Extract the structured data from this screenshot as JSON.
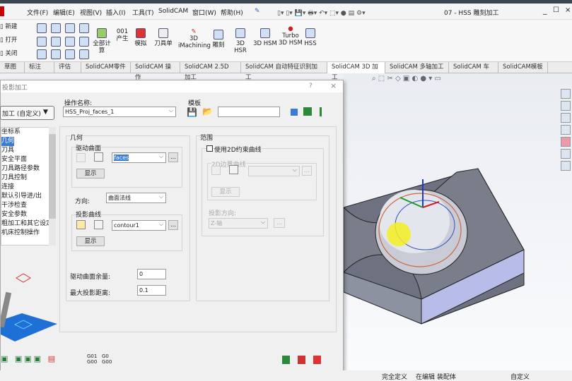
{
  "menu": [
    "文件(F)",
    "编辑(E)",
    "视图(V)",
    "插入(I)",
    "工具(T)",
    "SolidCAM",
    "窗口(W)",
    "帮助(H)"
  ],
  "window_title": "07 - HSS 雕刻加工",
  "ribbon": {
    "new": "新建",
    "open": "打开",
    "close": "关闭",
    "calc_all": "全部计算",
    "generate": "产生",
    "simulate": "模拟",
    "tool_sheet": "刀具单",
    "imachining": "3D iMachining",
    "engrave": "雕刻",
    "hsr": "3D HSR",
    "hsm": "3D HSM",
    "turbo": "Turbo 3D HSM",
    "hss": "HSS"
  },
  "tabs": [
    "草图",
    "标注",
    "评估",
    "SolidCAM零件",
    "SolidCAM 操作",
    "SolidCAM 2.5D 加工",
    "SolidCAM 自动特征识别加工",
    "SolidCAM 3D 加工",
    "SolidCAM 多轴加工",
    "SolidCAM 车削",
    "SolidCAM模板"
  ],
  "active_tab": "SolidCAM 3D 加工",
  "dialog": {
    "title": "投影加工",
    "help": "?",
    "close": "×",
    "type_select": "加工 (自定义)",
    "tree": [
      "坐标系",
      "几何",
      "刀具",
      "安全平面",
      "刀具路径参数",
      "刀具控制",
      "连接",
      "默认引导进/出",
      "干涉检查",
      "安全参数",
      "粗加工和其它设定",
      "机床控制操作"
    ],
    "selected_tree": "几何",
    "op_name_label": "操作名称:",
    "op_name": "HSS_Proj_faces_1",
    "template_label": "模板",
    "template_value": "",
    "geometry": {
      "title": "几何",
      "drive_label": "驱动曲面",
      "drive_value": "faces",
      "show": "显示",
      "direction_label": "方向:",
      "direction_value": "曲面法线",
      "proj_curve_label": "投影曲线",
      "proj_curve_value": "contour1",
      "show2": "显示",
      "drive_stock_label": "驱动曲面余量:",
      "drive_stock": "0",
      "max_proj_label": "最大投影距离:",
      "max_proj": "0.1"
    },
    "range": {
      "title": "范围",
      "use_2d": "使用2D约束曲线",
      "use_2d_checked": false,
      "boundary_label": "2D边界曲线",
      "boundary_value": "",
      "show": "显示",
      "proj_dir_label": "投影方向:",
      "proj_dir": "Z-轴"
    },
    "more": "...",
    "gcode1": "G01 G00",
    "gcode2": "G0 G00"
  },
  "status": {
    "s1": "完全定义",
    "s2": "在编辑 装配体",
    "s3": "自定义"
  }
}
